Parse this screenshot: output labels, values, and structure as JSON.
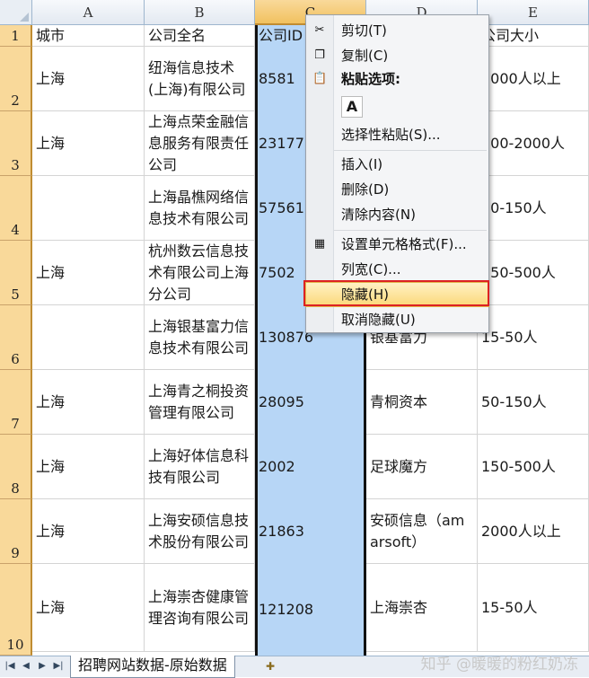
{
  "columns": [
    "A",
    "B",
    "C",
    "D",
    "E"
  ],
  "rows": [
    {
      "num": "1",
      "a": "城市",
      "b": "公司全名",
      "c": "公司ID",
      "d": "",
      "e": "公司大小"
    },
    {
      "num": "2",
      "a": "上海",
      "b": "纽海信息技术(上海)有限公司",
      "c": "8581",
      "d": "",
      "e": "2000人以上"
    },
    {
      "num": "3",
      "a": "上海",
      "b": "上海点荣金融信息服务有限责任公司",
      "c": "23177",
      "d": "",
      "e": "500-2000人"
    },
    {
      "num": "4",
      "a": "",
      "b": "上海晶樵网络信息技术有限公司",
      "c": "57561",
      "d": "",
      "e": "50-150人"
    },
    {
      "num": "5",
      "a": "上海",
      "b": "杭州数云信息技术有限公司上海分公司",
      "c": "7502",
      "d": "",
      "e": "150-500人"
    },
    {
      "num": "6",
      "a": "",
      "b": "上海银基富力信息技术有限公司",
      "c": "130876",
      "d": "银基富力",
      "e": "15-50人"
    },
    {
      "num": "7",
      "a": "上海",
      "b": "上海青之桐投资管理有限公司",
      "c": "28095",
      "d": "青桐资本",
      "e": "50-150人"
    },
    {
      "num": "8",
      "a": "上海",
      "b": "上海好体信息科技有限公司",
      "c": "2002",
      "d": "足球魔方",
      "e": "150-500人"
    },
    {
      "num": "9",
      "a": "上海",
      "b": "上海安硕信息技术股份有限公司",
      "c": "21863",
      "d": "安硕信息（amarsoft）",
      "e": "2000人以上"
    },
    {
      "num": "10",
      "a": "上海",
      "b": "上海崇杏健康管理咨询有限公司",
      "c": "121208",
      "d": "上海崇杏",
      "e": "15-50人"
    }
  ],
  "context_menu": {
    "cut": "剪切(T)",
    "copy": "复制(C)",
    "paste_options": "粘贴选项:",
    "paste_a": "A",
    "paste_special": "选择性粘贴(S)...",
    "insert": "插入(I)",
    "delete": "删除(D)",
    "clear": "清除内容(N)",
    "format_cells": "设置单元格格式(F)...",
    "column_width": "列宽(C)...",
    "hide": "隐藏(H)",
    "unhide": "取消隐藏(U)"
  },
  "sheet_tab": "招聘网站数据-原始数据",
  "watermark": "知乎 @暖暖的粉红奶冻"
}
